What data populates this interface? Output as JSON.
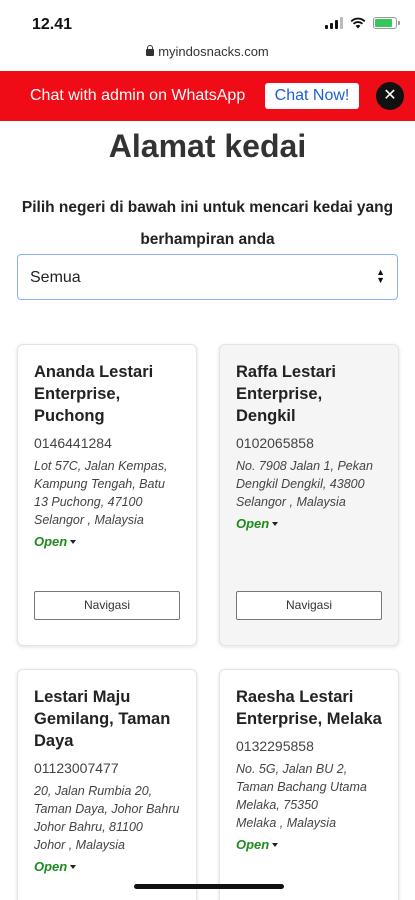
{
  "status_bar": {
    "time": "12.41",
    "battery_level": 0.85
  },
  "url_bar": {
    "domain": "myindosnacks.com"
  },
  "whatsapp_banner": {
    "text": "Chat with admin on WhatsApp",
    "button_label": "Chat Now!",
    "close_label": "✕"
  },
  "page": {
    "title": "Alamat kedai",
    "instructions": "Pilih negeri di bawah ini untuk mencari kedai yang berhampiran anda",
    "state_select": {
      "value": "Semua"
    }
  },
  "stores": [
    {
      "name": "Ananda Lestari Enterprise, Puchong",
      "phone": "0146441284",
      "address": [
        "Lot 57C, Jalan Kempas, Kampung Tengah, Batu 13 Puchong, 47100",
        "Selangor , Malaysia"
      ],
      "status": "Open",
      "nav_label": "Navigasi"
    },
    {
      "name": "Raffa Lestari Enterprise, Dengkil",
      "phone": "0102065858",
      "address": [
        "No. 7908 Jalan 1, Pekan Dengkil Dengkil, 43800",
        "Selangor , Malaysia"
      ],
      "status": "Open",
      "nav_label": "Navigasi"
    },
    {
      "name": "Lestari Maju Gemilang, Taman Daya",
      "phone": "01123007477",
      "address": [
        "20, Jalan Rumbia 20, Taman Daya, Johor Bahru",
        "Johor Bahru, 81100",
        "Johor , Malaysia"
      ],
      "status": "Open"
    },
    {
      "name": "Raesha Lestari Enterprise, Melaka",
      "phone": "0132295858",
      "address": [
        "No. 5G, Jalan BU 2, Taman Bachang Utama",
        "Melaka, 75350",
        "Melaka , Malaysia"
      ],
      "status": "Open"
    }
  ],
  "colors": {
    "banner_red": "#ef0c17",
    "open_green": "#1e8a1e",
    "button_blue": "#1b5fd9"
  }
}
